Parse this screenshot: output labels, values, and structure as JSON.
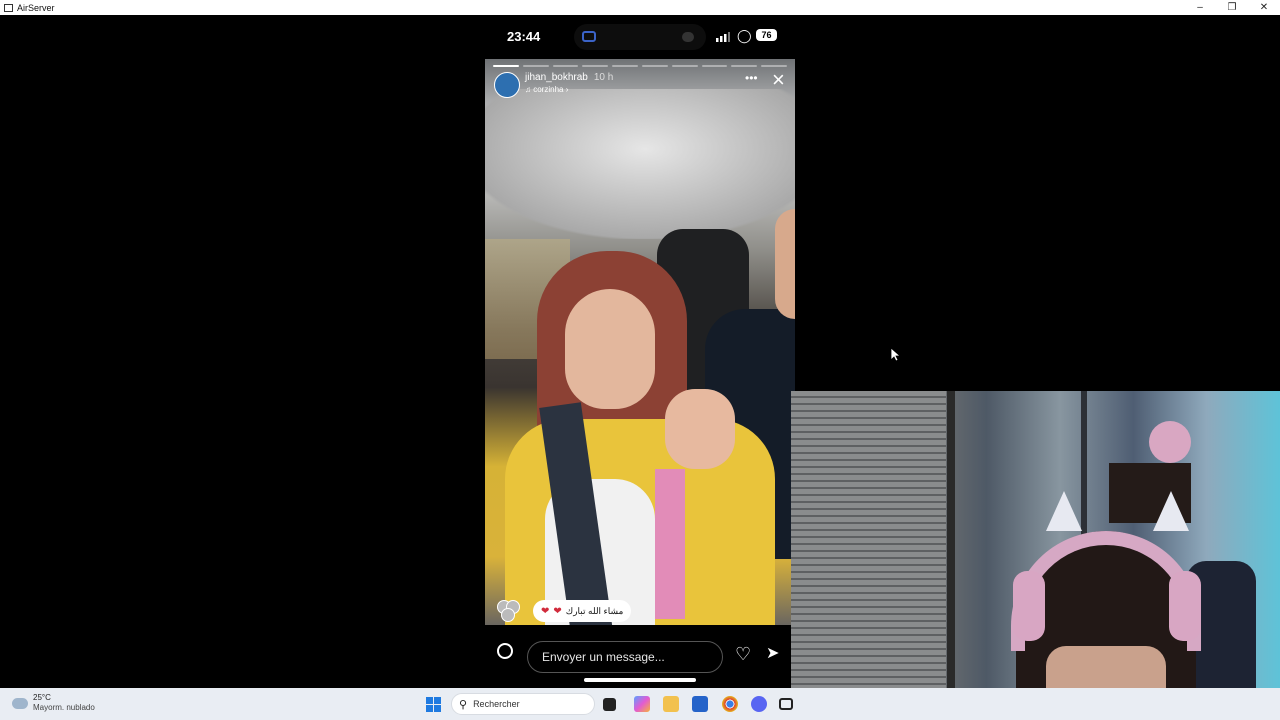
{
  "window": {
    "title": "AirServer"
  },
  "phone": {
    "time": "23:44",
    "battery": "76",
    "story": {
      "username": "jihan_bokhrab",
      "time_ago": "10 h",
      "music": "corzinha",
      "reaction": "مشاء الله تبارك",
      "reply_placeholder": "Envoyer un message..."
    }
  },
  "taskbar": {
    "weather_temp": "25°C",
    "weather_desc": "Mayorm. nublado",
    "search_label": "Rechercher"
  },
  "colors": {
    "accent_taskbar": "#1f7ae0",
    "story_shirt": "#e9c43b"
  }
}
